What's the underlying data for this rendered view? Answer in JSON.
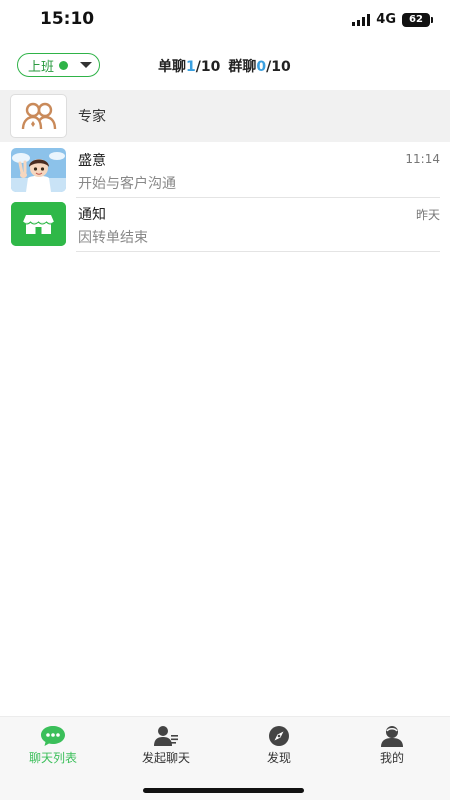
{
  "status_bar": {
    "time": "15:10",
    "network": "4G",
    "battery": "62"
  },
  "header": {
    "work_status": {
      "label": "上班",
      "dot_color": "#2fb348"
    },
    "single_chat": {
      "label": "单聊",
      "current": "1",
      "max": "/10"
    },
    "group_chat": {
      "label": "群聊",
      "current": "0",
      "max": "/10"
    }
  },
  "expert_group": {
    "label": "专家",
    "icon": "people-icon"
  },
  "chats": [
    {
      "name": "盛意",
      "preview": "开始与客户沟通",
      "time": "11:14",
      "avatar": "user-photo"
    },
    {
      "name": "通知",
      "preview": "因转单结束",
      "time": "昨天",
      "avatar": "store-icon"
    }
  ],
  "tabs": [
    {
      "label": "聊天列表",
      "icon": "chat-bubble-icon",
      "active": true
    },
    {
      "label": "发起聊天",
      "icon": "add-contact-icon",
      "active": false
    },
    {
      "label": "发现",
      "icon": "compass-icon",
      "active": false
    },
    {
      "label": "我的",
      "icon": "profile-icon",
      "active": false
    }
  ],
  "colors": {
    "accent_green": "#3bbf5a",
    "counter_blue": "#3aa0e0",
    "notice_green": "#2fb848"
  }
}
